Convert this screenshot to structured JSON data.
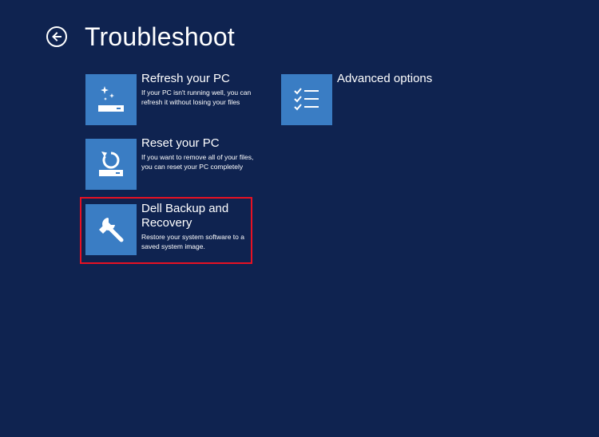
{
  "header": {
    "title": "Troubleshoot"
  },
  "tiles": [
    {
      "title": "Refresh your PC",
      "description": "If your PC isn't running well, you can refresh it without losing your files",
      "icon": "refresh-pc-icon"
    },
    {
      "title": "Reset your PC",
      "description": "If you want to remove all of your files, you can reset your PC completely",
      "icon": "reset-pc-icon"
    },
    {
      "title": "Dell Backup and Recovery",
      "description": "Restore your system software to a saved system image.",
      "icon": "wrench-icon"
    },
    {
      "title": "Advanced options",
      "description": "",
      "icon": "checklist-icon"
    }
  ],
  "colors": {
    "background": "#0f2350",
    "tile": "#3a7dc4",
    "highlight": "#e81123"
  }
}
